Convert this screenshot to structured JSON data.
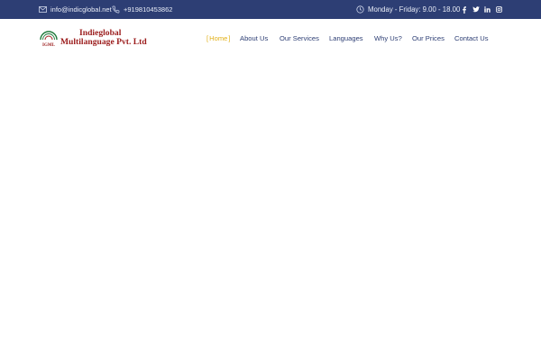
{
  "topbar": {
    "email": "info@indicglobal.net",
    "phone": "+919810453862",
    "hours": "Monday - Friday: 9.00 - 18.00",
    "icons": [
      "mail-icon",
      "phone-icon",
      "clock-icon"
    ],
    "social": [
      "facebook-icon",
      "twitter-icon",
      "linkedin-icon",
      "instagram-icon"
    ]
  },
  "logo": {
    "badge": "IGML",
    "line1": "Indieglobal",
    "line2": "Multilanguage Pvt. Ltd"
  },
  "nav": {
    "items": [
      {
        "label": "Home",
        "active": true
      },
      {
        "label": "About Us"
      },
      {
        "label": "Our Services"
      },
      {
        "label": "Languages"
      },
      {
        "label": "Why Us?"
      },
      {
        "label": "Our Prices"
      },
      {
        "label": "Contact Us"
      }
    ],
    "active_bracket_open": "[",
    "active_bracket_close": "]"
  },
  "colors": {
    "topbar_bg": "#2d3e74",
    "nav_text": "#2d3e74",
    "active": "#e2b11a",
    "logo_red": "#9b1c1c",
    "logo_green": "#1d7a3a"
  }
}
